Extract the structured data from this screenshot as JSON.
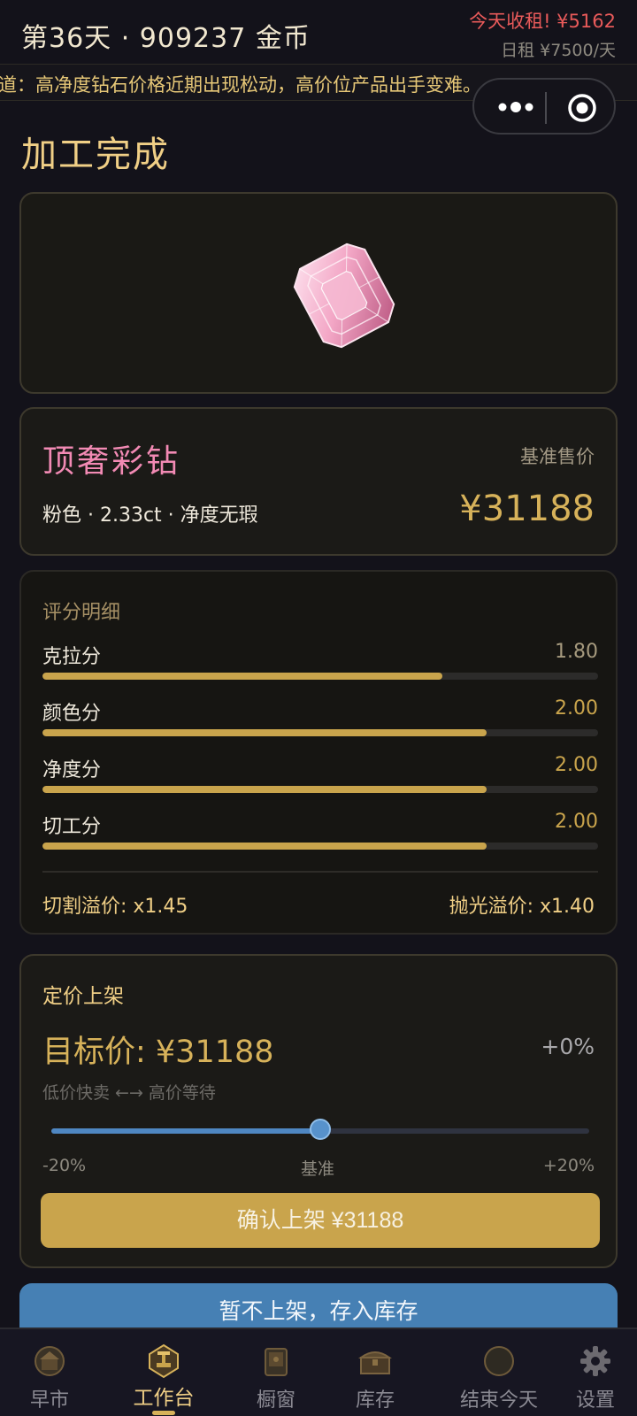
{
  "header": {
    "day_gold": "第36天 · 909237 金币",
    "rent_today": "今天收租! ¥5162",
    "daily_rent": "日租 ¥7500/天"
  },
  "ticker": {
    "text": "道：高净度钻石价格近期出现松动，高价位产品出手变难。"
  },
  "capsule": {
    "menu_icon": "more-dots-icon",
    "close_icon": "target-circle-icon"
  },
  "page": {
    "title": "加工完成"
  },
  "gem": {
    "image_icon": "pink-emerald-cut-diamond-icon",
    "name": "顶奢彩钻",
    "specs": "粉色 · 2.33ct · 净度无瑕",
    "price_label": "基准售价",
    "price": "¥31188"
  },
  "scores": {
    "title": "评分明细",
    "items": [
      {
        "label": "克拉分",
        "value": "1.80",
        "fill": 0.72,
        "value_color": "#a69a7e"
      },
      {
        "label": "颜色分",
        "value": "2.00",
        "fill": 0.8,
        "value_color": "#c9a44c"
      },
      {
        "label": "净度分",
        "value": "2.00",
        "fill": 0.8,
        "value_color": "#c9a44c"
      },
      {
        "label": "切工分",
        "value": "2.00",
        "fill": 0.8,
        "value_color": "#c9a44c"
      }
    ],
    "cut_premium": "切割溢价: x1.45",
    "polish_premium": "抛光溢价: x1.40"
  },
  "pricing": {
    "title": "定价上架",
    "target": "目标价: ¥31188",
    "percent": "+0%",
    "hint": "低价快卖 ←→ 高价等待",
    "slider_value": 0,
    "slider_min": "-20%",
    "slider_mid": "基准",
    "slider_max": "+20%",
    "confirm_label": "确认上架 ¥31188"
  },
  "store_button": {
    "label": "暂不上架，存入库存"
  },
  "tabs": [
    {
      "label": "早市",
      "icon": "morning-market-icon",
      "active": false
    },
    {
      "label": "工作台",
      "icon": "workbench-icon",
      "active": true
    },
    {
      "label": "橱窗",
      "icon": "display-window-icon",
      "active": false
    },
    {
      "label": "库存",
      "icon": "treasure-chest-icon",
      "active": false
    },
    {
      "label": "结束今天",
      "icon": "moon-icon",
      "active": false
    },
    {
      "label": "设置",
      "icon": "gear-icon",
      "active": false
    }
  ],
  "colors": {
    "background": "#13121a",
    "gold": "#d7b25a",
    "pink": "#f28ab4",
    "blue": "#4680b4",
    "red": "#e85a5a"
  }
}
